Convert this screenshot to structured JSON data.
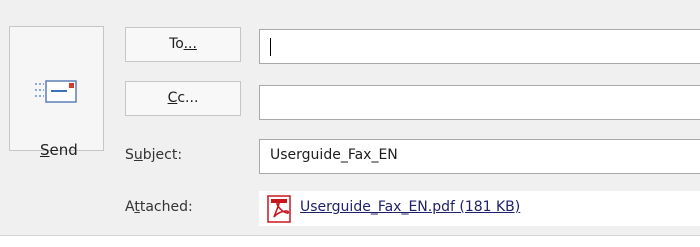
{
  "send": {
    "label_mnemonic": "S",
    "label_rest": "end"
  },
  "recipients": {
    "to_label_pre": "To",
    "to_label_suffix": "...",
    "to_value": "",
    "cc_label_pre": "C",
    "cc_label_rest": "c..."
  },
  "subject": {
    "label_pre": "S",
    "label_mnemonic": "u",
    "label_rest": "bject:",
    "value": "Userguide_Fax_EN"
  },
  "attached": {
    "label_pre": "A",
    "label_mnemonic": "t",
    "label_rest": "tached:",
    "file_link": "Userguide_Fax_EN.pdf (181 KB)",
    "icon": "pdf-icon"
  },
  "colors": {
    "background": "#f0f0f0",
    "button": "#f6f6f6",
    "border": "#c6c6c6",
    "pdf_red": "#c8161d",
    "link": "#1f1f6b"
  }
}
